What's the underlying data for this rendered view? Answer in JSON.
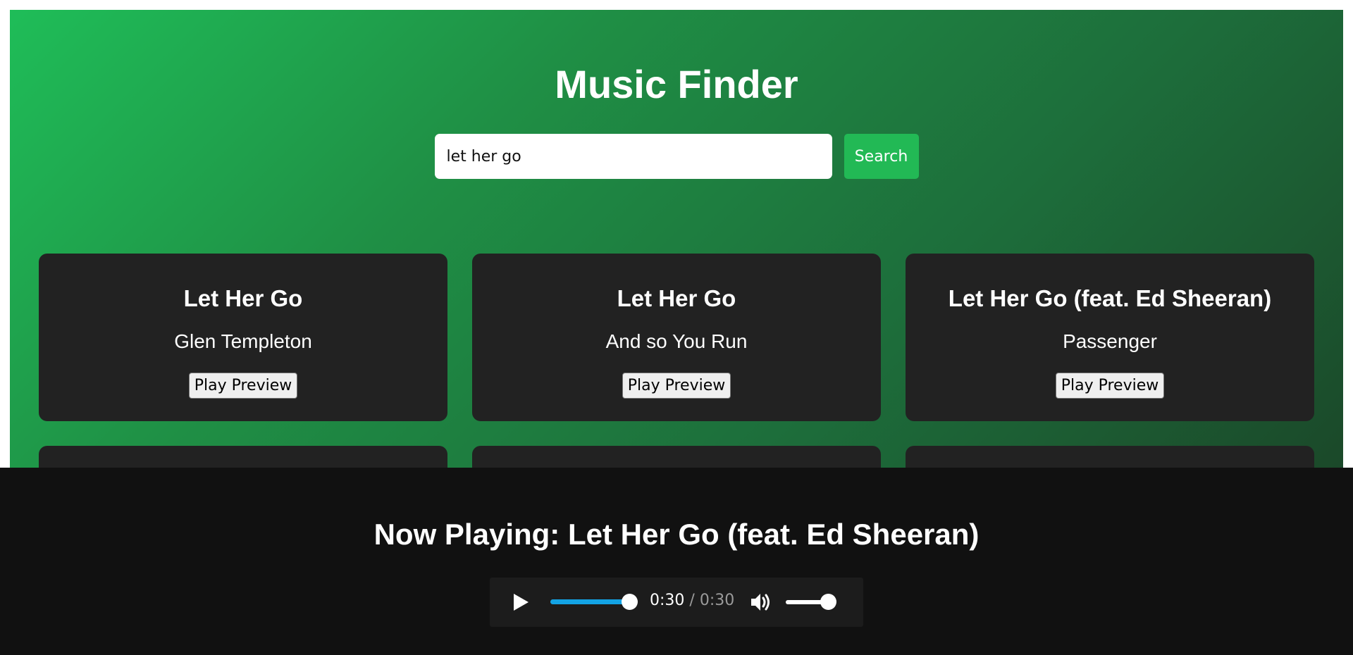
{
  "app": {
    "title": "Music Finder"
  },
  "search": {
    "value": "let her go",
    "placeholder": "",
    "button_label": "Search"
  },
  "results": [
    {
      "title": "Let Her Go",
      "artist": "Glen Templeton",
      "button_label": "Play Preview"
    },
    {
      "title": "Let Her Go",
      "artist": "And so You Run",
      "button_label": "Play Preview"
    },
    {
      "title": "Let Her Go (feat. Ed Sheeran)",
      "artist": "Passenger",
      "button_label": "Play Preview"
    },
    {
      "title": "",
      "artist": "",
      "button_label": ""
    },
    {
      "title": "",
      "artist": "",
      "button_label": ""
    },
    {
      "title": "",
      "artist": "",
      "button_label": ""
    }
  ],
  "player": {
    "now_playing": "Now Playing: Let Her Go (feat. Ed Sheeran)",
    "current_time": "0:30",
    "separator": "/",
    "duration": "0:30",
    "progress_fraction": 1.0,
    "volume_fraction": 0.85,
    "icons": {
      "play": "play-icon",
      "volume": "volume-icon"
    }
  },
  "colors": {
    "accent": "#22b955",
    "card_bg": "#222222",
    "player_bg": "#111111",
    "progress_fill": "#13a3e4"
  }
}
